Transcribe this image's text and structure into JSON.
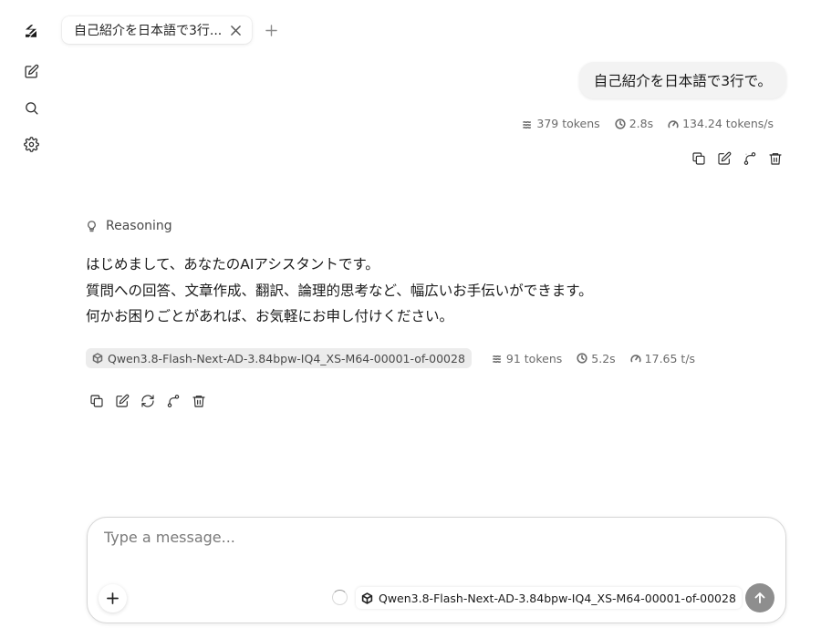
{
  "tab": {
    "title": "自己紹介を日本語で3行...",
    "close_icon": "x-icon",
    "add_icon": "plus-icon"
  },
  "rail": {
    "icons": [
      "app-logo-icon",
      "new-chat-icon",
      "search-icon",
      "gear-icon"
    ]
  },
  "user_message": {
    "text": "自己紹介を日本語で3行で。",
    "stats": {
      "tokens": "379 tokens",
      "time": "2.8s",
      "speed": "134.24 tokens/s"
    }
  },
  "assistant": {
    "reasoning_label": "Reasoning",
    "lines": [
      "はじめまして、あなたのAIアシスタントです。",
      "質問への回答、文章作成、翻訳、論理的思考など、幅広いお手伝いができます。",
      "何かお困りごとがあれば、お気軽にお申し付けください。"
    ],
    "model": "Qwen3.8-Flash-Next-AD-3.84bpw-IQ4_XS-M64-00001-of-00028",
    "stats": {
      "tokens": "91 tokens",
      "time": "5.2s",
      "speed": "17.65 t/s"
    }
  },
  "composer": {
    "placeholder": "Type a message...",
    "value": "",
    "model": "Qwen3.8-Flash-Next-AD-3.84bpw-IQ4_XS-M64-00001-of-00028"
  },
  "colors": {
    "send_button": "#8e8e8e",
    "bubble": "#f3f3f3",
    "chip": "#ececec"
  }
}
